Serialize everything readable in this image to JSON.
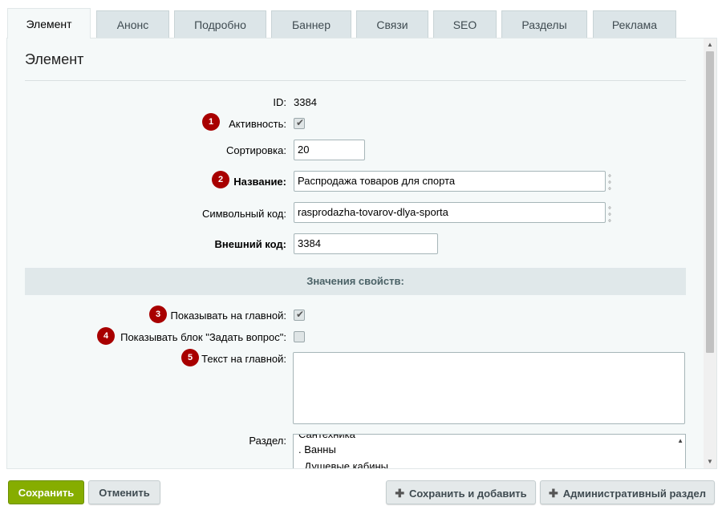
{
  "tabs": [
    {
      "label": "Элемент",
      "active": true
    },
    {
      "label": "Анонс"
    },
    {
      "label": "Подробно"
    },
    {
      "label": "Баннер"
    },
    {
      "label": "Связи"
    },
    {
      "label": "SEO"
    },
    {
      "label": "Разделы"
    },
    {
      "label": "Реклама"
    }
  ],
  "panel": {
    "title": "Элемент"
  },
  "form": {
    "id_label": "ID:",
    "id_value": "3384",
    "active_label": "Активность:",
    "active_checked": true,
    "sort_label": "Сортировка:",
    "sort_value": "20",
    "name_label": "Название:",
    "name_value": "Распродажа товаров для спорта",
    "code_label": "Символьный код:",
    "code_value": "rasprodazha-tovarov-dlya-sporta",
    "xml_label": "Внешний код:",
    "xml_value": "3384",
    "section_header": "Значения свойств:",
    "show_main_label": "Показывать на главной:",
    "show_main_checked": true,
    "show_ask_label": "Показывать блок \"Задать вопрос\":",
    "show_ask_checked": false,
    "main_text_label": "Текст на главной:",
    "main_text_value": "",
    "section_label": "Раздел:",
    "section_options": [
      "Сантехника",
      ". Ванны",
      ". Душевые кабины"
    ]
  },
  "badges": [
    "1",
    "2",
    "3",
    "4",
    "5"
  ],
  "buttons": {
    "save": "Сохранить",
    "cancel": "Отменить",
    "save_add": "Сохранить и добавить",
    "admin": "Административный раздел"
  },
  "colors": {
    "save_button": "#86ad00",
    "badge": "#a80000",
    "panel_bg": "#f5f9f9"
  }
}
